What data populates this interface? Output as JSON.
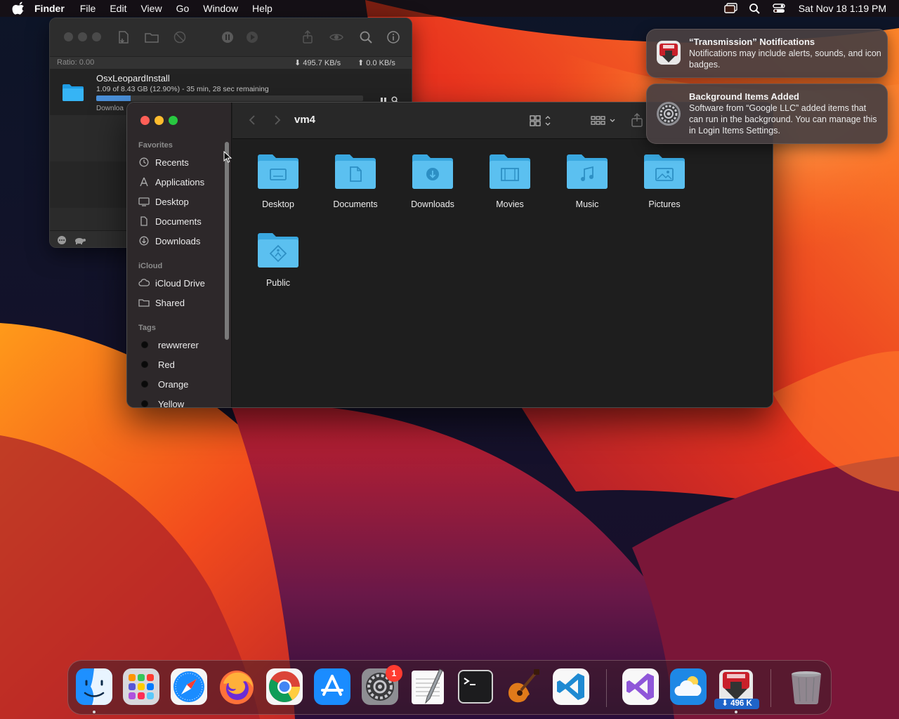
{
  "menubar": {
    "app_name": "Finder",
    "menus": [
      "File",
      "Edit",
      "View",
      "Go",
      "Window",
      "Help"
    ],
    "clock": "Sat Nov 18  1:19 PM",
    "status_icons": [
      "screen-mirroring-icon",
      "spotlight-search-icon",
      "control-center-icon"
    ]
  },
  "transmission": {
    "ratio": "Ratio: 0.00",
    "download_speed": "495.7 KB/s",
    "upload_speed": "0.0 KB/s",
    "torrent": {
      "name": "OsxLeopardInstall",
      "progress_text": "1.09 of 8.43 GB (12.90%) - 35 min, 28 sec remaining",
      "progress_percent": 12.9,
      "status": "Downloa"
    }
  },
  "finder": {
    "title": "vm4",
    "sidebar": {
      "favorites_label": "Favorites",
      "favorites": [
        {
          "label": "Recents",
          "icon": "clock-icon"
        },
        {
          "label": "Applications",
          "icon": "applications-icon"
        },
        {
          "label": "Desktop",
          "icon": "desktop-icon"
        },
        {
          "label": "Documents",
          "icon": "document-icon"
        },
        {
          "label": "Downloads",
          "icon": "download-icon"
        }
      ],
      "icloud_label": "iCloud",
      "icloud": [
        {
          "label": "iCloud Drive",
          "icon": "cloud-icon"
        },
        {
          "label": "Shared",
          "icon": "shared-folder-icon"
        }
      ],
      "tags_label": "Tags",
      "tags": [
        "rewwrerer",
        "Red",
        "Orange",
        "Yellow"
      ]
    },
    "folders": [
      {
        "label": "Desktop",
        "glyph": "desktop-glyph"
      },
      {
        "label": "Documents",
        "glyph": "document-glyph"
      },
      {
        "label": "Downloads",
        "glyph": "download-glyph"
      },
      {
        "label": "Movies",
        "glyph": "film-glyph"
      },
      {
        "label": "Music",
        "glyph": "music-glyph"
      },
      {
        "label": "Pictures",
        "glyph": "picture-glyph"
      },
      {
        "label": "Public",
        "glyph": "public-glyph"
      }
    ]
  },
  "notifications": [
    {
      "title": "“Transmission” Notifications",
      "body": "Notifications may include alerts, sounds, and icon badges.",
      "icon": "transmission-app-icon"
    },
    {
      "title": "Background Items Added",
      "body": "Software from “Google LLC” added items that can run in the background. You can manage this in Login Items Settings.",
      "icon": "system-settings-icon"
    }
  ],
  "dock": {
    "apps": [
      "Finder",
      "Launchpad",
      "Safari",
      "Firefox",
      "Google Chrome",
      "App Store",
      "System Settings",
      "TextEdit",
      "Terminal",
      "GarageBand",
      "Visual Studio Code",
      "Visual Studio",
      "Weather",
      "Transmission",
      "Trash"
    ],
    "settings_badge": "1",
    "transmission_speed": "⬇ 496 K"
  },
  "colors": {
    "folder_blue": "#5bc0f0",
    "close": "#ff5f57",
    "minimize": "#febc2e",
    "maximize": "#28c840",
    "badge_red": "#ff3b30"
  }
}
